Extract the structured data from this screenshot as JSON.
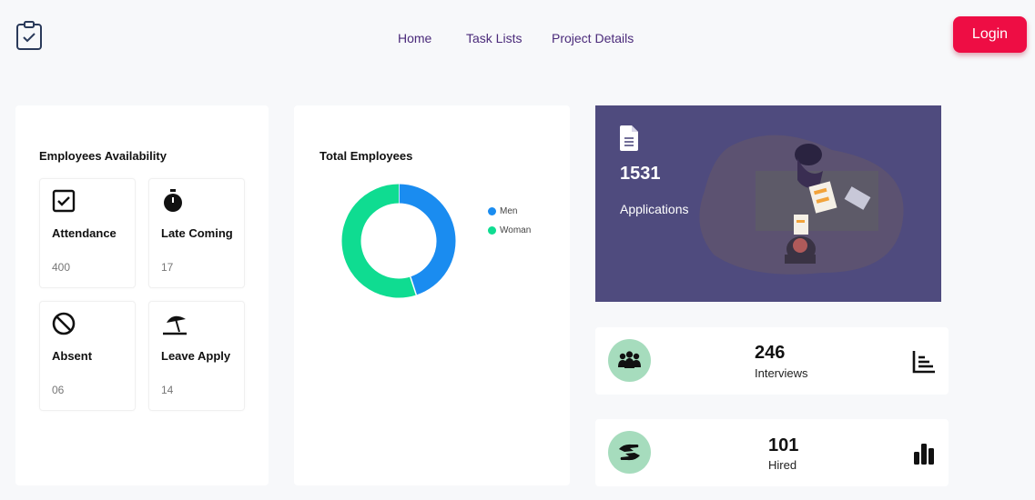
{
  "nav": {
    "items": [
      {
        "label": "Home"
      },
      {
        "label": "Task Lists"
      },
      {
        "label": "Project Details"
      }
    ],
    "login_label": "Login"
  },
  "availability": {
    "title": "Employees Availability",
    "tiles": [
      {
        "label": "Attendance",
        "value": "400",
        "icon": "checkbox-icon"
      },
      {
        "label": "Late Coming",
        "value": "17",
        "icon": "stopwatch-icon"
      },
      {
        "label": "Absent",
        "value": "06",
        "icon": "ban-icon"
      },
      {
        "label": "Leave Apply",
        "value": "14",
        "icon": "beach-umbrella-icon"
      }
    ]
  },
  "total_employees": {
    "title": "Total Employees",
    "legend": [
      {
        "name": "Men",
        "color": "#1a8cf0"
      },
      {
        "name": "Woman",
        "color": "#0fdc91"
      }
    ]
  },
  "chart_data": {
    "type": "pie",
    "donut": true,
    "series": [
      {
        "name": "Men",
        "value": 45,
        "color": "#1a8cf0"
      },
      {
        "name": "Woman",
        "value": 55,
        "color": "#0fdc91"
      }
    ],
    "legend_position": "right"
  },
  "applications": {
    "value": "1531",
    "label": "Applications",
    "bg_color": "#4f4b7e"
  },
  "interviews": {
    "value": "246",
    "label": "Interviews"
  },
  "hired": {
    "value": "101",
    "label": "Hired"
  },
  "colors": {
    "accent": "#ee0d44",
    "nav_text": "#4a2a7a",
    "stat_circle": "#a6dcbd"
  }
}
